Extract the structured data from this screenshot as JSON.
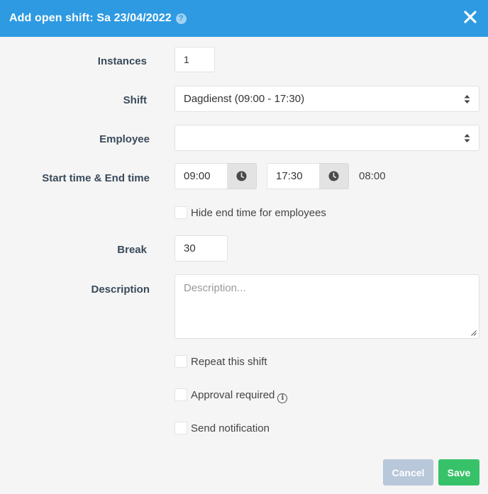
{
  "header": {
    "title": "Add open shift: Sa 23/04/2022",
    "help_glyph": "?",
    "background": "#2e9ae2"
  },
  "form": {
    "instances": {
      "label": "Instances",
      "value": "1"
    },
    "shift": {
      "label": "Shift",
      "selected": "Dagdienst (09:00 - 17:30)"
    },
    "employee": {
      "label": "Employee",
      "selected": ""
    },
    "time": {
      "label": "Start time & End time",
      "start": "09:00",
      "end": "17:30",
      "duration": "08:00"
    },
    "hide_end_time": {
      "label": "Hide end time for employees",
      "checked": false
    },
    "break": {
      "label": "Break",
      "value": "30"
    },
    "description": {
      "label": "Description",
      "placeholder": "Description..."
    },
    "repeat": {
      "label": "Repeat this shift",
      "checked": false
    },
    "approval": {
      "label": "Approval required",
      "checked": false,
      "info_glyph": "i"
    },
    "notification": {
      "label": "Send notification",
      "checked": false
    }
  },
  "footer": {
    "cancel_label": "Cancel",
    "save_label": "Save",
    "cancel_color": "#b8c7da",
    "save_color": "#37c26a"
  },
  "icons": [
    "help-icon",
    "close-icon",
    "select-arrows-icon",
    "clock-icon",
    "info-icon",
    "resize-grip-icon"
  ]
}
